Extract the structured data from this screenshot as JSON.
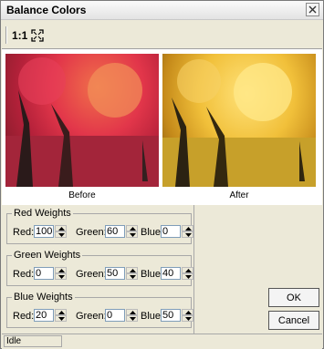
{
  "window": {
    "title": "Balance Colors"
  },
  "toolbar": {
    "actual_size_label": "1:1",
    "fit_icon": "fit-screen-icon"
  },
  "preview": {
    "before_caption": "Before",
    "after_caption": "After"
  },
  "red_weights": {
    "legend": "Red Weights",
    "red_label": "Red:",
    "red_value": "100",
    "green_label": "Green:",
    "green_value": "60",
    "blue_label": "Blue:",
    "blue_value": "0"
  },
  "green_weights": {
    "legend": "Green Weights",
    "red_label": "Red:",
    "red_value": "0",
    "green_label": "Green:",
    "green_value": "50",
    "blue_label": "Blue:",
    "blue_value": "40"
  },
  "blue_weights": {
    "legend": "Blue Weights",
    "red_label": "Red:",
    "red_value": "20",
    "green_label": "Green:",
    "green_value": "0",
    "blue_label": "Blue:",
    "blue_value": "50"
  },
  "buttons": {
    "ok": "OK",
    "cancel": "Cancel"
  },
  "status": {
    "text": "Idle"
  },
  "colors": {
    "title_bg": "#f2f2f2",
    "dialog_bg": "#ece9d8",
    "input_border": "#7f9db9"
  }
}
